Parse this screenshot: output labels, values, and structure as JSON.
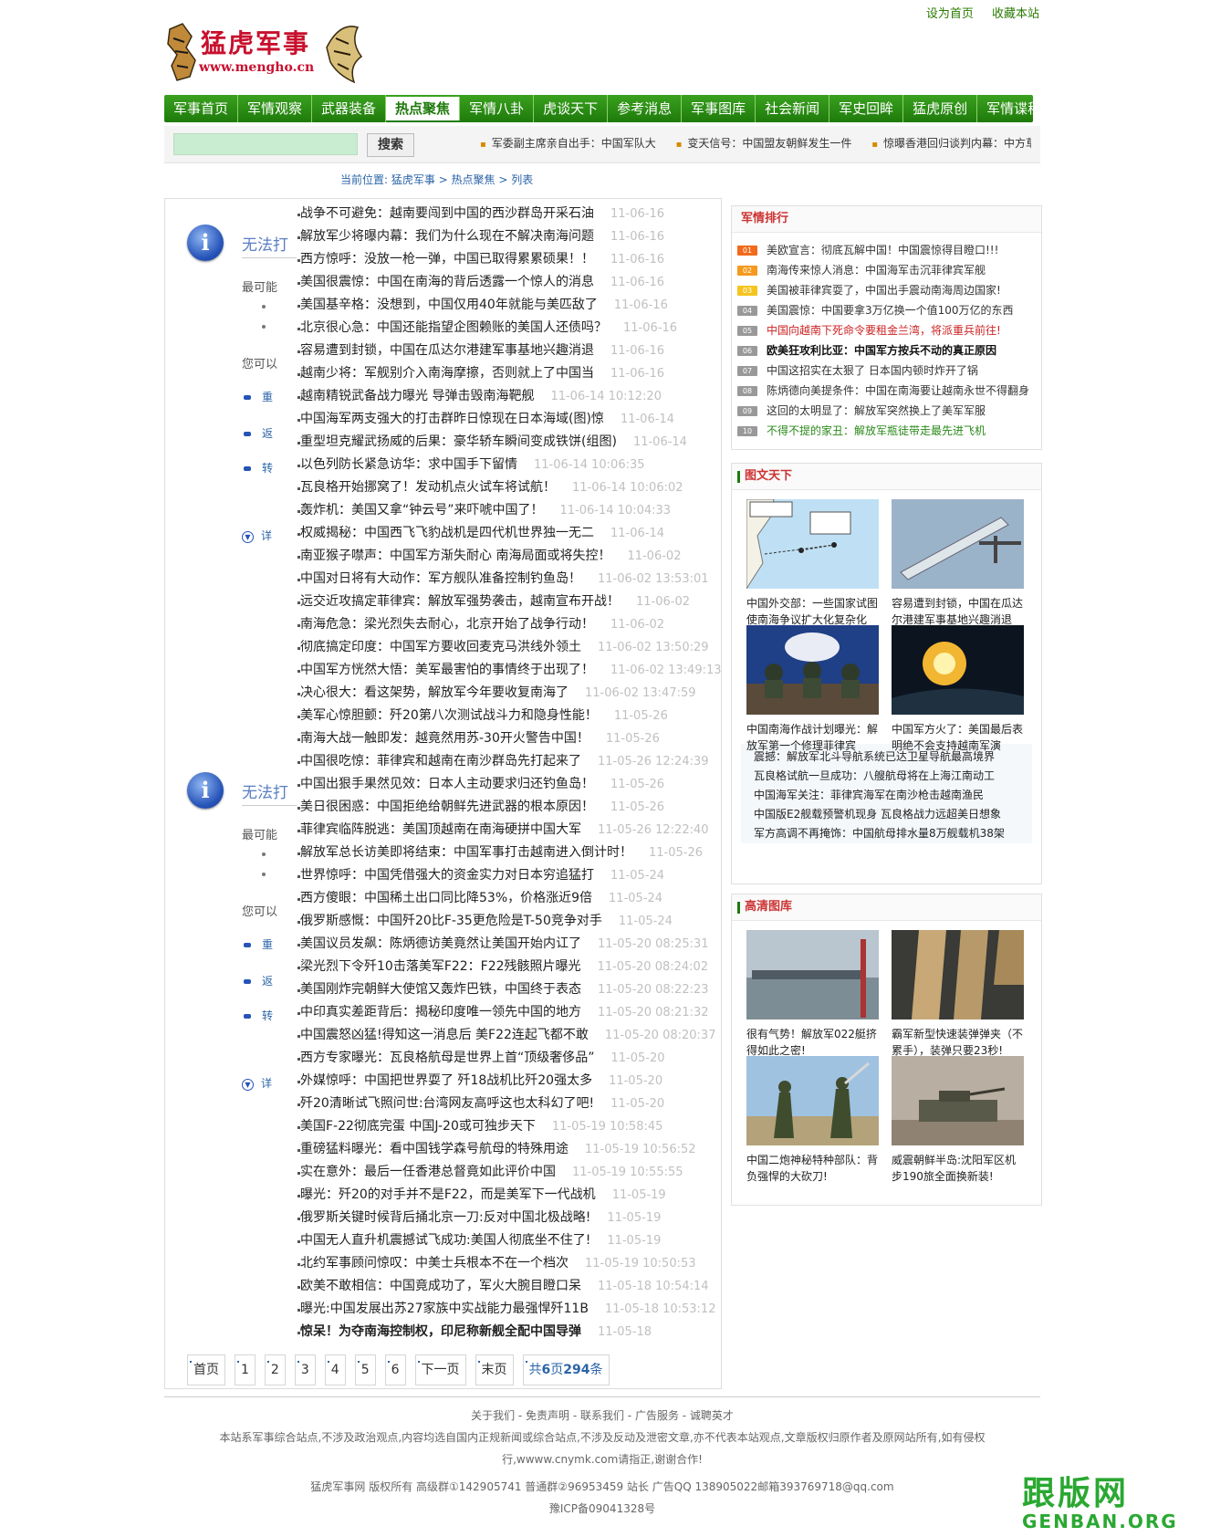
{
  "site": {
    "logo_title": "猛虎军事",
    "logo_url": "www.mengho.cn",
    "top_links": [
      "设为首页",
      "收藏本站"
    ]
  },
  "nav": {
    "items": [
      "军事首页",
      "军情观察",
      "武器装备",
      "热点聚焦",
      "军情八卦",
      "虎谈天下",
      "参考消息",
      "军事图库",
      "社会新闻",
      "军史回眸",
      "猛虎原创",
      "军情谍秘"
    ],
    "active_index": 3
  },
  "search": {
    "button_label": "搜索",
    "placeholder": ""
  },
  "ticker": [
    "军委副主席亲自出手：中国军队大",
    "变天信号：中国盟友朝鲜发生一件",
    "惊曝香港回归谈判内幕：中方草案"
  ],
  "breadcrumb": "当前位置: 猛虎军事 > 热点聚焦 > 列表",
  "ghost_panel": {
    "title": "无法打",
    "text1": "最可能",
    "text2": "您可以",
    "bullets": [
      "重",
      "返",
      "转"
    ],
    "more": "详"
  },
  "articles": [
    {
      "title": "战争不可避免：越南要闯到中国的西沙群岛开采石油",
      "date": "11-06-16"
    },
    {
      "title": "解放军少将曝内幕：我们为什么现在不解决南海问题",
      "date": "11-06-16"
    },
    {
      "title": "西方惊呼：没放一枪一弹，中国已取得累累硕果！！",
      "date": "11-06-16"
    },
    {
      "title": "美国很震惊：中国在南海的背后透露一个惊人的消息",
      "date": "11-06-16"
    },
    {
      "title": "美国基辛格：没想到，中国仅用40年就能与美匹敌了",
      "date": "11-06-16"
    },
    {
      "title": "北京很心急：中国还能指望企图赖账的美国人还债吗？",
      "date": "11-06-16"
    },
    {
      "title": "容易遭到封锁，中国在瓜达尔港建军事基地兴趣消退",
      "date": "11-06-16"
    },
    {
      "title": "越南少将：军舰别介入南海摩擦，否则就上了中国当",
      "date": "11-06-16"
    },
    {
      "title": "越南精锐武备战力曝光 导弹击毁南海靶舰",
      "date": "11-06-14 10:12:20"
    },
    {
      "title": "中国海军两支强大的打击群昨日惊现在日本海域(图)惊",
      "date": "11-06-14"
    },
    {
      "title": "重型坦克耀武扬威的后果：豪华轿车瞬间变成铁饼(组图)",
      "date": "11-06-14"
    },
    {
      "title": "以色列防长紧急访华：求中国手下留情",
      "date": "11-06-14 10:06:35"
    },
    {
      "title": "瓦良格开始挪窝了！发动机点火试车将试航！",
      "date": "11-06-14 10:06:02"
    },
    {
      "title": "轰炸机：美国又拿“钟云号”来吓唬中国了！",
      "date": "11-06-14 10:04:33"
    },
    {
      "title": "权威揭秘：中国西飞飞豹战机是四代机世界独一无二",
      "date": "11-06-14"
    },
    {
      "title": "南亚猴子噤声：中国军方渐失耐心 南海局面或将失控！",
      "date": "11-06-02"
    },
    {
      "title": "中国对日将有大动作：军方舰队准备控制钓鱼岛！",
      "date": "11-06-02 13:53:01"
    },
    {
      "title": "远交近攻搞定菲律宾：解放军强势袭击，越南宣布开战！",
      "date": "11-06-02"
    },
    {
      "title": "南海危急：梁光烈失去耐心，北京开始了战争行动！",
      "date": "11-06-02"
    },
    {
      "title": "彻底搞定印度：中国军方要收回麦克马洪线外领土",
      "date": "11-06-02 13:50:29"
    },
    {
      "title": "中国军方恍然大悟：美军最害怕的事情终于出现了！",
      "date": "11-06-02 13:49:13"
    },
    {
      "title": "决心很大：看这架势，解放军今年要收复南海了",
      "date": "11-06-02 13:47:59"
    },
    {
      "title": "美军心惊胆颤：歼20第八次测试战斗力和隐身性能！",
      "date": "11-05-26"
    },
    {
      "title": "南海大战一触即发：越竟然用苏-30开火警告中国！",
      "date": "11-05-26"
    },
    {
      "title": "中国很吃惊：菲律宾和越南在南沙群岛先打起来了",
      "date": "11-05-26 12:24:39"
    },
    {
      "title": "中国出狠手果然见效：日本人主动要求归还钓鱼岛！",
      "date": "11-05-26"
    },
    {
      "title": "美日很困惑：中国拒绝给朝鲜先进武器的根本原因！",
      "date": "11-05-26"
    },
    {
      "title": "菲律宾临阵脱逃：美国顶越南在南海硬拼中国大军",
      "date": "11-05-26 12:22:40"
    },
    {
      "title": "解放军总长访美即将结束：中国军事打击越南进入倒计时！",
      "date": "11-05-26"
    },
    {
      "title": "世界惊呼：中国凭借强大的资金实力对日本穷追猛打",
      "date": "11-05-24"
    },
    {
      "title": "西方傻眼：中国稀土出口同比降53%，价格涨近9倍",
      "date": "11-05-24"
    },
    {
      "title": "俄罗斯感慨：中国歼20比F-35更危险是T-50竞争对手",
      "date": "11-05-24"
    },
    {
      "title": "美国议员发飙：陈炳德访美竟然让美国开始内讧了",
      "date": "11-05-20 08:25:31"
    },
    {
      "title": "梁光烈下令歼10击落美军F22：F22残骸照片曝光",
      "date": "11-05-20 08:24:02"
    },
    {
      "title": "美国刚炸完朝鲜大使馆又轰炸巴铁，中国终于表态",
      "date": "11-05-20 08:22:23"
    },
    {
      "title": "中印真实差距背后：揭秘印度唯一领先中国的地方",
      "date": "11-05-20 08:21:32"
    },
    {
      "title": "中国震怒凶猛!得知这一消息后 美F22连起飞都不敢",
      "date": "11-05-20 08:20:37"
    },
    {
      "title": "西方专家曝光：瓦良格航母是世界上首“顶级奢侈品”",
      "date": "11-05-20"
    },
    {
      "title": "外媒惊呼：中国把世界耍了 歼18战机比歼20强太多",
      "date": "11-05-20"
    },
    {
      "title": "歼20清晰试飞照问世:台湾网友高呼这也太科幻了吧!",
      "date": "11-05-20"
    },
    {
      "title": "美国F-22彻底完蛋 中国J-20或可独步天下",
      "date": "11-05-19 10:58:45"
    },
    {
      "title": "重磅猛料曝光：看中国钱学森号航母的特殊用途",
      "date": "11-05-19 10:56:52"
    },
    {
      "title": "实在意外：最后一任香港总督竟如此评价中国",
      "date": "11-05-19 10:55:55"
    },
    {
      "title": "曝光：歼20的对手并不是F22，而是美军下一代战机",
      "date": "11-05-19"
    },
    {
      "title": "俄罗斯关键时候背后捅北京一刀:反对中国北极战略!",
      "date": "11-05-19"
    },
    {
      "title": "中国无人直升机震撼试飞成功:美国人彻底坐不住了!",
      "date": "11-05-19"
    },
    {
      "title": "北约军事顾问惊叹：中美士兵根本不在一个档次",
      "date": "11-05-19 10:50:53"
    },
    {
      "title": "欧美不敢相信：中国竟成功了，军火大腕目瞪口呆",
      "date": "11-05-18 10:54:14"
    },
    {
      "title": "曝光:中国发展出苏27家族中实战能力最强悍歼11B",
      "date": "11-05-18 10:53:12"
    },
    {
      "title": "惊呆！为夺南海控制权，印尼称新舰全配中国导弹",
      "date": "11-05-18",
      "bold": true
    }
  ],
  "pager": {
    "items": [
      "首页",
      "1",
      "2",
      "3",
      "4",
      "5",
      "6",
      "下一页",
      "末页"
    ],
    "total_prefix": "共",
    "total_pages": "6",
    "total_mid": "页",
    "total_count": "294",
    "total_suffix": "条"
  },
  "ranking": {
    "title": "军情排行",
    "items": [
      {
        "num": "01",
        "text": "美欧宣言：彻底瓦解中国！中国震惊得目瞪口!!!",
        "color": "#333333",
        "badge": "#f26a1b"
      },
      {
        "num": "02",
        "text": "南海传来惊人消息：中国海军击沉菲律宾军舰",
        "color": "#333333",
        "badge": "#f59a1e"
      },
      {
        "num": "03",
        "text": "美国被菲律宾耍了，中国出手震动南海周边国家!",
        "color": "#333333",
        "badge": "#f5c41e"
      },
      {
        "num": "04",
        "text": "美国震惊：中国要拿3万亿换一个值100万亿的东西",
        "color": "#333333",
        "badge": "#999999"
      },
      {
        "num": "05",
        "text": "中国向越南下死命令要租金兰湾，将派重兵前往!",
        "color": "#cc2222",
        "badge": "#999999"
      },
      {
        "num": "06",
        "text": "欧美狂攻利比亚：中国军方按兵不动的真正原因",
        "color": "#111111",
        "badge": "#999999",
        "bold": true
      },
      {
        "num": "07",
        "text": "中国这招实在太狠了 日本国内顿时炸开了锅",
        "color": "#333333",
        "badge": "#999999"
      },
      {
        "num": "08",
        "text": "陈炳德向美提条件：中国在南海要让越南永世不得翻身",
        "color": "#333333",
        "badge": "#999999"
      },
      {
        "num": "09",
        "text": "这回的太明显了：解放军突然换上了美军军服",
        "color": "#333333",
        "badge": "#999999"
      },
      {
        "num": "10",
        "text": "不得不提的家丑：解放军瓶徒带走最先进飞机",
        "color": "#2a8a1a",
        "badge": "#999999"
      }
    ]
  },
  "picture_world": {
    "title": "图文天下",
    "items": [
      {
        "caption": "中国外交部：一些国家试图使南海争议扩大化复杂化",
        "image": "map-image"
      },
      {
        "caption": "容易遭到封锁，中国在瓜达尔港建军事基地兴趣消退",
        "image": "missile-image"
      },
      {
        "caption": "中国南海作战计划曝光：解放军第一个修理菲律宾",
        "image": "press-conference-image"
      },
      {
        "caption": "中国军方火了：美国最后表明绝不会支持越南军演",
        "image": "explosion-image"
      }
    ],
    "links": [
      "震撼：解放军北斗导航系统已达卫星导航最高境界",
      "瓦良格试航一旦成功：八艘航母将在上海江南动工",
      "中国海军关注：菲律宾海军在南沙枪击越南渔民",
      "中国版E2舰载预警机现身 瓦良格战力远超美日想象",
      "军方高调不再掩饰：中国航母排水量8万舰载机38架"
    ]
  },
  "hd_gallery": {
    "title": "高清图库",
    "items": [
      {
        "caption": "很有气势！解放军022艇挤得如此之密!",
        "image": "boats-image"
      },
      {
        "caption": "霸军新型快速装弹弹夹（不累手），装弹只要23秒!",
        "image": "magazine-image"
      },
      {
        "caption": "中国二炮神秘特种部队：背负强悍的大砍刀!",
        "image": "soldiers-image"
      },
      {
        "caption": "威震朝鲜半岛:沈阳军区机步190旅全面换新装!",
        "image": "tank-image"
      }
    ]
  },
  "footer": {
    "links": "关于我们 - 免责声明 - 联系我们 - 广告服务 - 诚聘英才",
    "notice1": "本站系军事综合站点,不涉及政治观点,内容均选自国内正规新闻或综合站点,不涉及反动及泄密文章,亦不代表本站观点,文章版权归原作者及原网站所有,如有侵权",
    "notice2": "行,wwww.cnymk.com请指正,谢谢合作!",
    "copyright": "猛虎军事网  版权所有  高级群①142905741  普通群②96953459  站长  广告QQ  138905022邮箱393769718@qq.com",
    "icp": "豫ICP备09041328号"
  },
  "watermark": {
    "big": "跟版网",
    "small": "GENBAN.ORG"
  }
}
